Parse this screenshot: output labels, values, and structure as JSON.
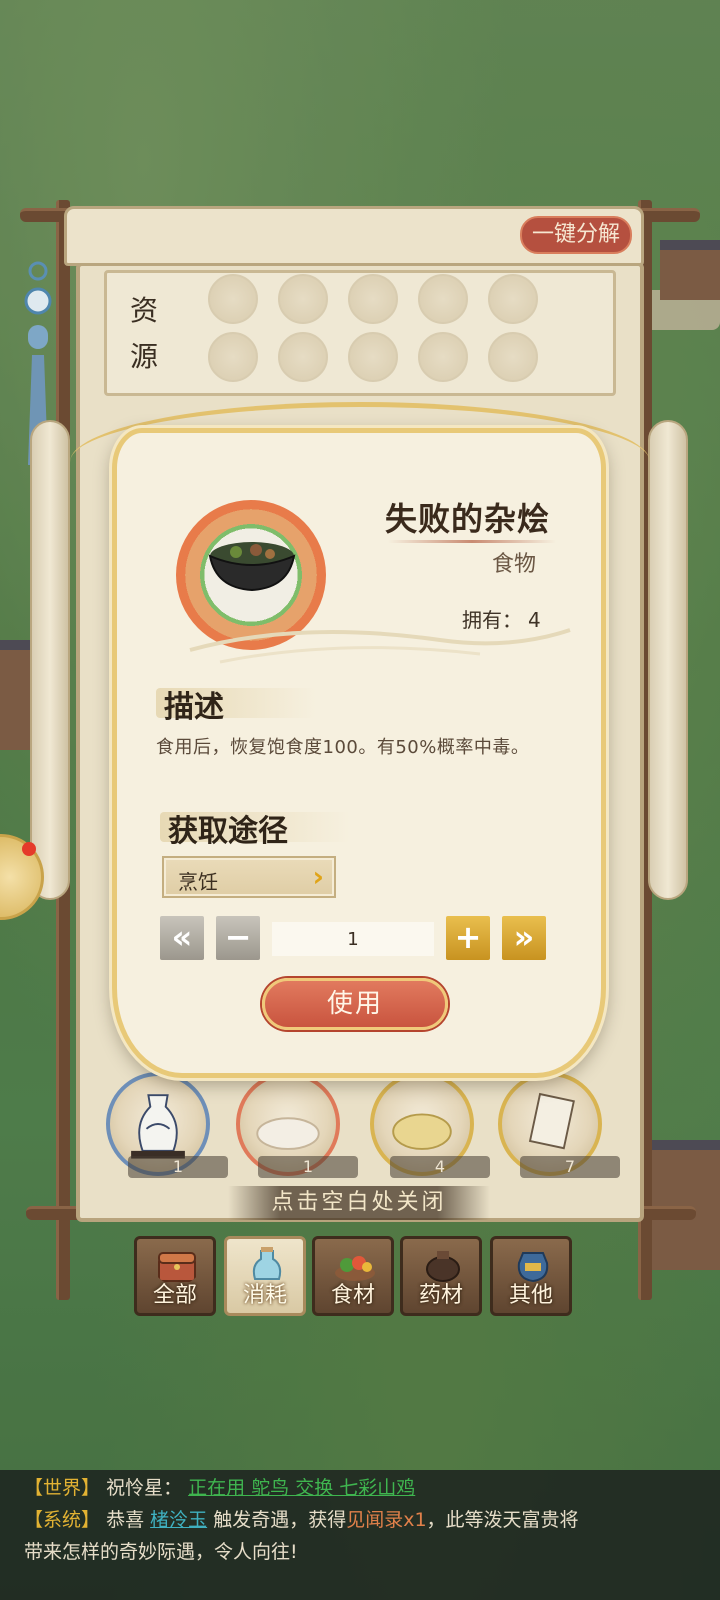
{
  "board": {
    "decompose_label": "一键分解",
    "resource_title": "资源"
  },
  "popup": {
    "item_name": "失败的杂烩",
    "item_type": "食物",
    "own_label": "拥有：",
    "own_count": "4",
    "desc_title": "描述",
    "description": "食用后，恢复饱食度100。有50%概率中毒。",
    "source_title": "获取途径",
    "source_label": "烹饪",
    "quantity": "1",
    "use_label": "使用",
    "icon": "food-bowl-icon"
  },
  "background_items": [
    {
      "count": "1",
      "icon": "wine-pot-icon"
    },
    {
      "count": "1",
      "icon": "dumpling-icon"
    },
    {
      "count": "4",
      "icon": "food-plate-icon"
    },
    {
      "count": "7",
      "icon": "book-icon"
    }
  ],
  "close_hint": "点击空白处关闭",
  "tabs": [
    {
      "label": "全部",
      "icon": "treasure-chest-icon",
      "active": false
    },
    {
      "label": "消耗",
      "icon": "potion-icon",
      "active": true
    },
    {
      "label": "食材",
      "icon": "vegetables-icon",
      "active": false
    },
    {
      "label": "药材",
      "icon": "herb-pot-icon",
      "active": false
    },
    {
      "label": "其他",
      "icon": "jar-icon",
      "active": false
    }
  ],
  "chat": {
    "line1": {
      "tag": "【世界】",
      "name": "祝怜星：",
      "message": "正在用 鸵鸟 交换 七彩山鸡"
    },
    "line2": {
      "tag": "【系统】",
      "text1": "恭喜",
      "player": "楮泠玉",
      "text2": "触发奇遇，获得",
      "reward": "见闻录x1",
      "text3": "，此等泼天富贵将"
    },
    "line3": "带来怎样的奇妙际遇，令人向往!"
  },
  "colors": {
    "accent_red": "#c9543f",
    "gold": "#e0a418",
    "chat_world": "#3fb54f",
    "chat_system": "#e2b233"
  }
}
